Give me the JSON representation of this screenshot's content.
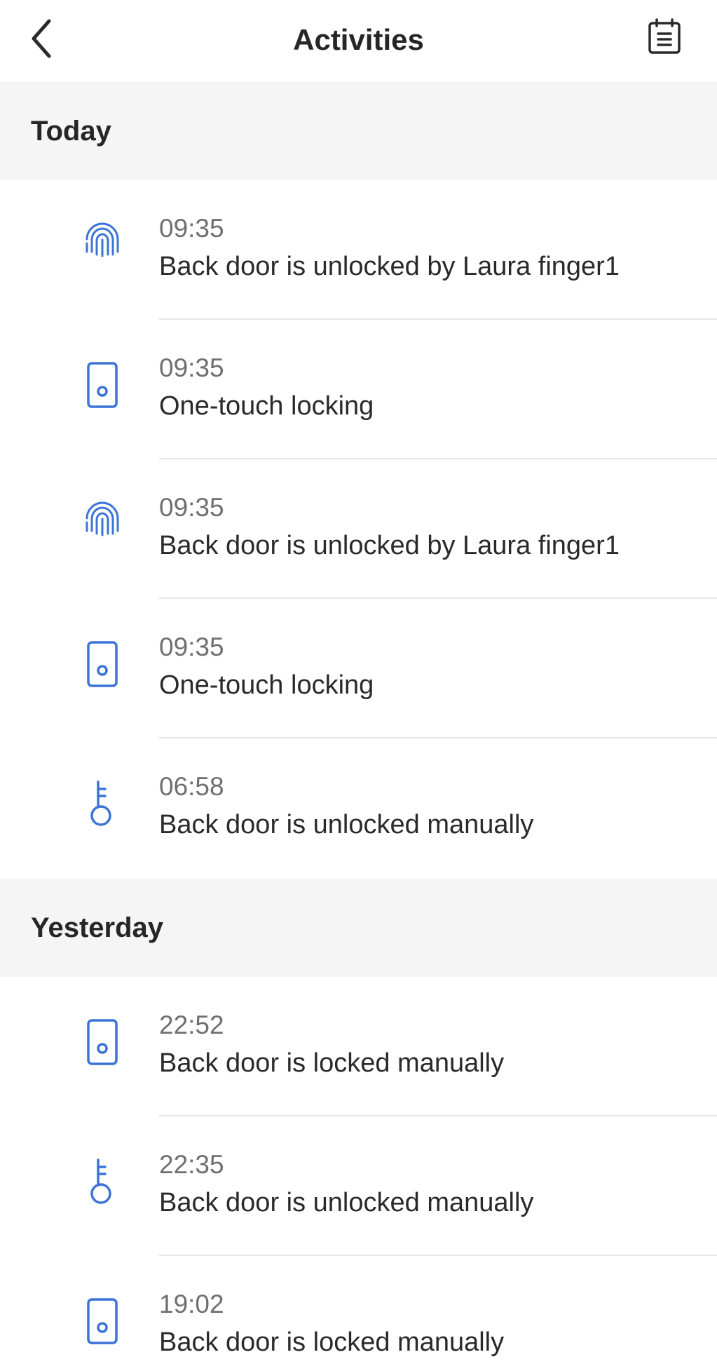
{
  "header": {
    "title": "Activities",
    "back_icon": "chevron-left-icon",
    "calendar_icon": "calendar-list-icon"
  },
  "colors": {
    "accent": "#3b73d6",
    "section_bg": "#f5f5f5",
    "divider": "#e6e6e6"
  },
  "sections": [
    {
      "label": "Today",
      "items": [
        {
          "time": "09:35",
          "description": "Back door is unlocked by Laura finger1",
          "icon": "fingerprint-icon"
        },
        {
          "time": "09:35",
          "description": "One-touch locking",
          "icon": "door-lock-icon"
        },
        {
          "time": "09:35",
          "description": "Back door is unlocked by Laura finger1",
          "icon": "fingerprint-icon"
        },
        {
          "time": "09:35",
          "description": "One-touch locking",
          "icon": "door-lock-icon"
        },
        {
          "time": "06:58",
          "description": "Back door is unlocked manually",
          "icon": "key-icon"
        }
      ]
    },
    {
      "label": "Yesterday",
      "items": [
        {
          "time": "22:52",
          "description": "Back door is locked manually",
          "icon": "door-lock-icon"
        },
        {
          "time": "22:35",
          "description": "Back door is unlocked manually",
          "icon": "key-icon"
        },
        {
          "time": "19:02",
          "description": "Back door is locked manually",
          "icon": "door-lock-icon"
        }
      ]
    }
  ]
}
